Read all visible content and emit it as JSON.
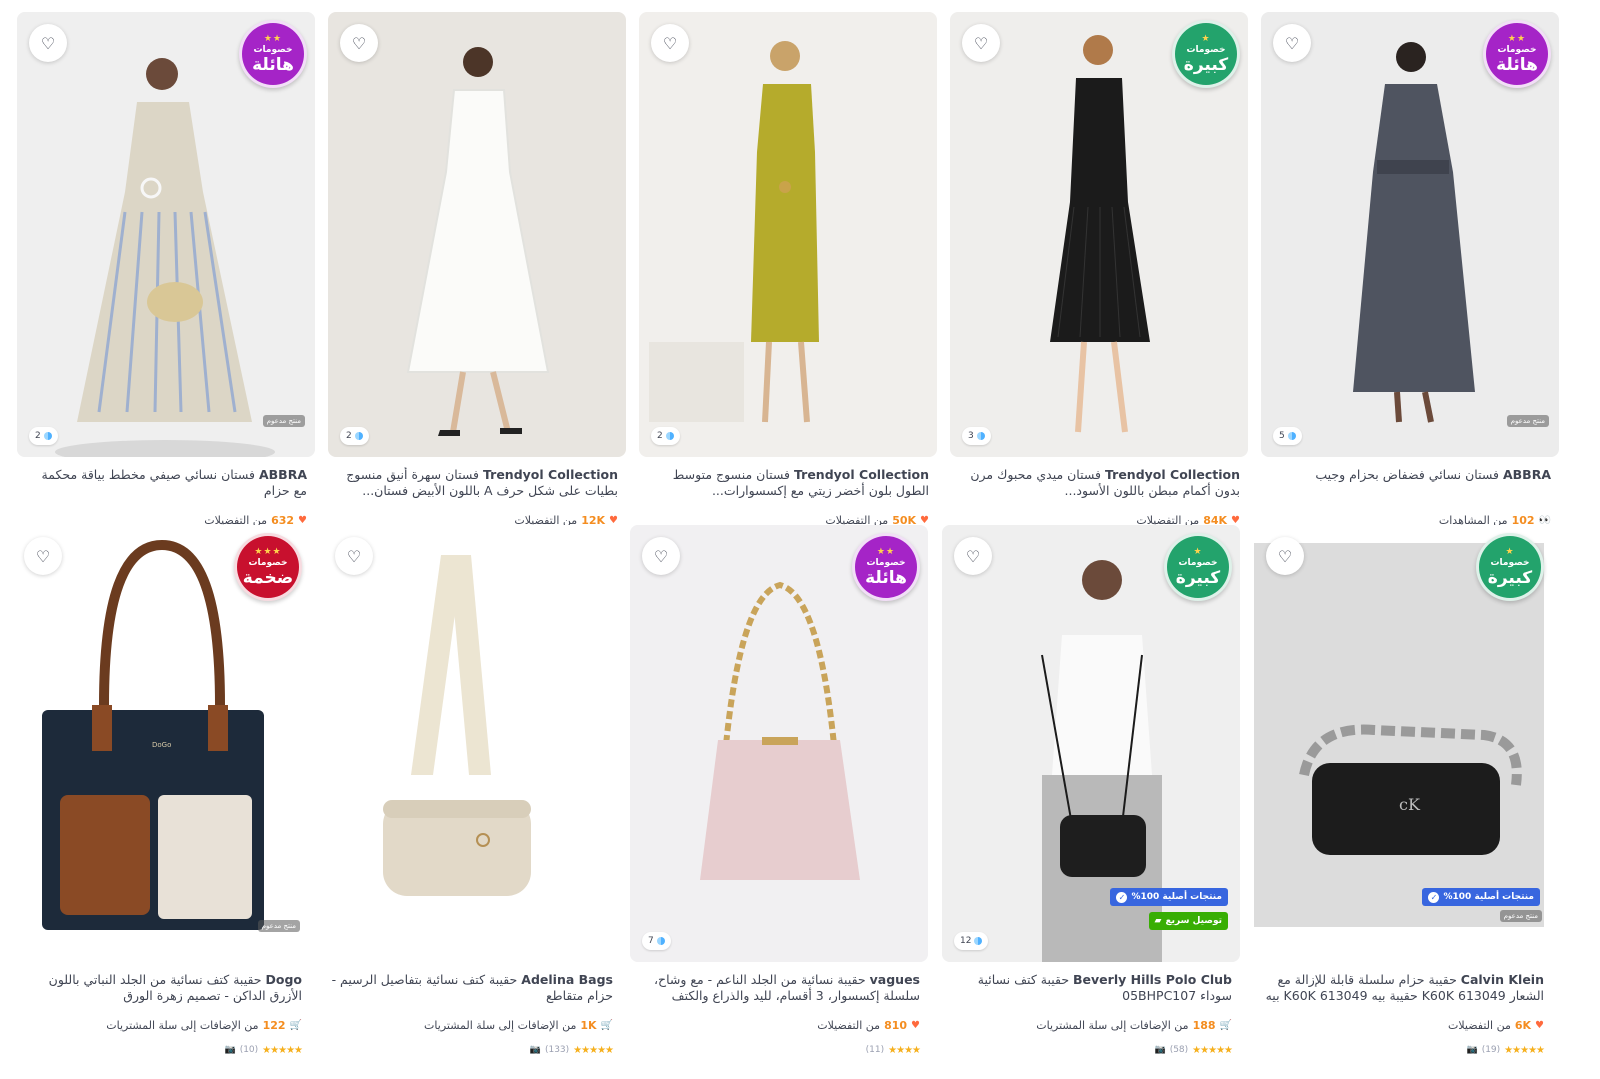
{
  "common": {
    "sponsored": "منتج مدعوم",
    "original": "منتجات أصلية 100%",
    "fast_delivery": "توصيل سريع"
  },
  "products": [
    {
      "brand": "ABBRA",
      "title": "فستان نسائي صيفي مخطط بياقة محكمة مع حزام",
      "stat_num": "632",
      "stat_text": "من التفضيلات",
      "stat_icon": "heart-icon",
      "badge_line1": "خصومات",
      "badge_line2": "هائلة",
      "badge_color": "#a524c7",
      "count": "2",
      "sponsored": true
    },
    {
      "brand": "Trendyol Collection",
      "title": "فستان سهرة أنيق منسوج بطيات على شكل حرف A باللون الأبيض فستان...",
      "stat_num": "12K",
      "stat_text": "من التفضيلات",
      "stat_icon": "heart-icon",
      "badge_line1": "",
      "badge_line2": "",
      "count": "2",
      "sponsored": false
    },
    {
      "brand": "Trendyol Collection",
      "title": "فستان منسوج متوسط الطول بلون أخضر زيتي مع إكسسوارات...",
      "stat_num": "50K",
      "stat_text": "من التفضيلات",
      "stat_icon": "heart-icon",
      "badge_line1": "",
      "badge_line2": "",
      "count": "2",
      "sponsored": false
    },
    {
      "brand": "Trendyol Collection",
      "title": "فستان ميدي محبوك مرن بدون أكمام مبطن باللون الأسود...",
      "stat_num": "84K",
      "stat_text": "من التفضيلات",
      "stat_icon": "heart-icon",
      "badge_line1": "خصومات",
      "badge_line2": "كبيرة",
      "badge_color": "#23a36c",
      "count": "3",
      "sponsored": false
    },
    {
      "brand": "ABBRA",
      "title": "فستان نسائي فضفاض بحزام وجيب",
      "stat_num": "102",
      "stat_text": "من المشاهدات",
      "stat_icon": "eyes-icon",
      "badge_line1": "خصومات",
      "badge_line2": "هائلة",
      "badge_color": "#a524c7",
      "count": "5",
      "sponsored": true
    },
    {
      "brand": "Dogo",
      "title": "حقيبة كتف نسائية من الجلد النباتي باللون الأزرق الداكن - تصميم زهرة الورق",
      "stat_num": "122",
      "stat_text": "من الإضافات إلى سلة المشتريات",
      "stat_icon": "cart-add-icon",
      "badge_line1": "خصومات",
      "badge_line2": "ضخمة",
      "badge_color": "#c8102e",
      "sponsored": true,
      "stars": "★★★★★",
      "reviews": "(10)"
    },
    {
      "brand": "Adelina Bags",
      "title": "حقيبة كتف نسائية بتفاصيل الرسيم - حزام متقاطع",
      "stat_num": "1K",
      "stat_text": "من الإضافات إلى سلة المشتريات",
      "stat_icon": "cart-add-icon",
      "badge_line1": "",
      "badge_line2": "",
      "sponsored": false,
      "stars": "★★★★★",
      "reviews": "(133)"
    },
    {
      "brand": "vagues",
      "title": "حقيبة نسائية من الجلد الناعم - مع وشاح، سلسلة إكسسوار، 3 أقسام، لليد والذراع والكتف",
      "stat_num": "810",
      "stat_text": "من التفضيلات",
      "stat_icon": "heart-icon",
      "badge_line1": "خصومات",
      "badge_line2": "هائلة",
      "badge_color": "#a524c7",
      "count": "7",
      "sponsored": false,
      "stars": "★★★★",
      "reviews": "(11)"
    },
    {
      "brand": "Beverly Hills Polo Club",
      "title": "حقيبة كتف نسائية سوداء 05BHPC107",
      "stat_num": "188",
      "stat_text": "من الإضافات إلى سلة المشتريات",
      "stat_icon": "cart-add-icon",
      "badge_line1": "خصومات",
      "badge_line2": "كبيرة",
      "badge_color": "#23a36c",
      "count": "12",
      "sponsored": false,
      "original": true,
      "fast": true,
      "stars": "★★★★★",
      "reviews": "(58)"
    },
    {
      "brand": "Calvin Klein",
      "title": "حقيبة حزام سلسلة قابلة للإزالة مع الشعار K60K 613049 حقيبة بيه K60K 613049 بيه",
      "stat_num": "6K",
      "stat_text": "من التفضيلات",
      "stat_icon": "heart-icon",
      "badge_line1": "خصومات",
      "badge_line2": "كبيرة",
      "badge_color": "#23a36c",
      "sponsored": true,
      "original": true,
      "stars": "★★★★★",
      "reviews": "(19)"
    }
  ]
}
